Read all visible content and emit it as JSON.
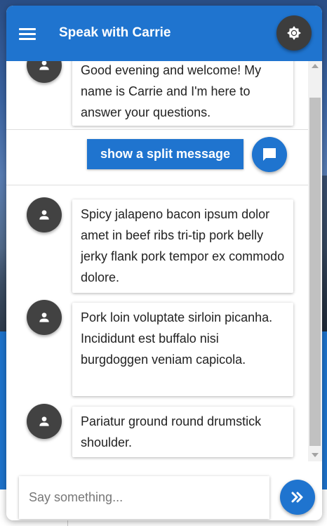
{
  "header": {
    "title": "Speak with Carrie"
  },
  "messages": [
    {
      "text": "Good evening and welcome! My name is Carrie and I'm here to answer your questions."
    },
    {
      "text": "Spicy jalapeno bacon ipsum dolor amet in beef ribs tri-tip pork belly jerky flank pork tempor ex commodo dolore."
    },
    {
      "text": "Pork loin voluptate sirloin picanha. Incididunt est buffalo nisi burgdoggen veniam capicola."
    },
    {
      "text": "Pariatur ground round drumstick shoulder."
    }
  ],
  "split_button": {
    "label": "show a split message"
  },
  "composer": {
    "placeholder": "Say something..."
  },
  "icons": {
    "menu": "hamburger-menu-icon",
    "settings": "settings-sun-icon",
    "avatar": "person-icon",
    "chat": "chat-bubble-icon",
    "send": "double-chevron-right-icon"
  },
  "colors": {
    "primary": "#1f74cf",
    "dark": "#424242"
  }
}
